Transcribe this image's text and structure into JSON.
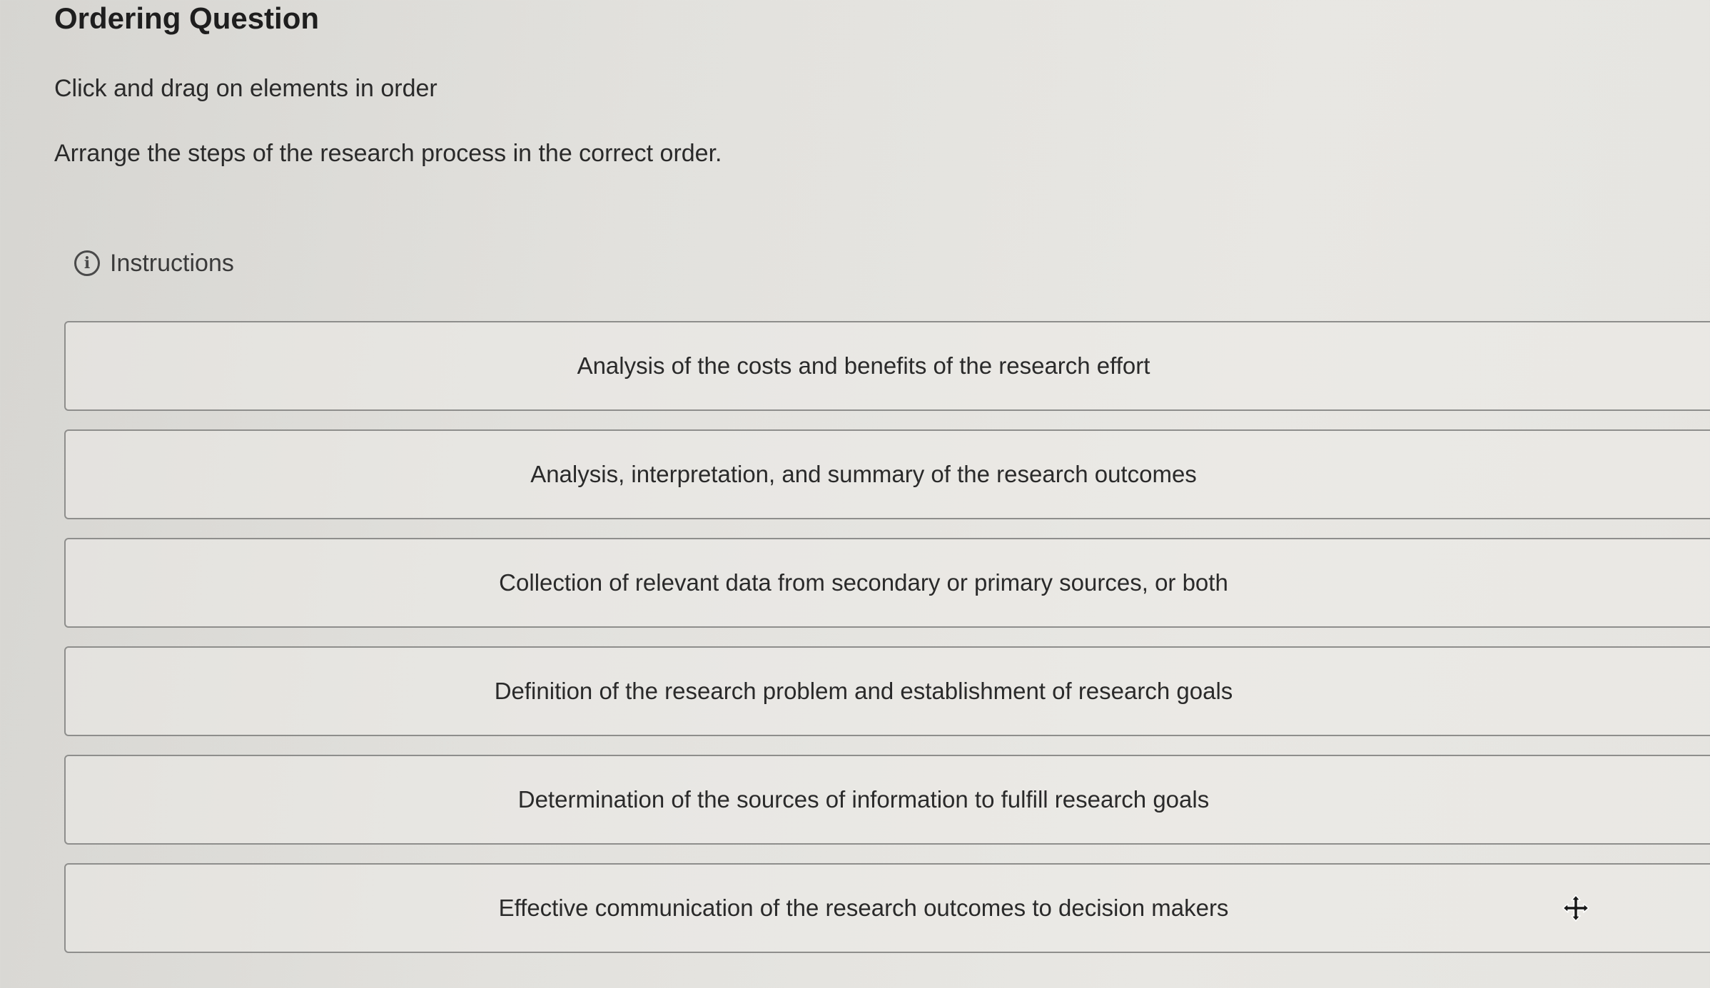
{
  "header": {
    "title": "Ordering Question",
    "subtitle": "Click and drag on elements in order",
    "prompt": "Arrange the steps of the research process in the correct order."
  },
  "instructions": {
    "icon": "info-icon",
    "label": "Instructions"
  },
  "items": [
    {
      "label": "Analysis of the costs and benefits of the research effort"
    },
    {
      "label": "Analysis, interpretation, and summary of the research outcomes"
    },
    {
      "label": "Collection of relevant data from secondary or primary sources, or both"
    },
    {
      "label": "Definition of the research problem and establishment of research goals"
    },
    {
      "label": "Determination of the sources of information to fulfill research goals"
    },
    {
      "label": "Effective communication of the research outcomes to decision makers"
    }
  ],
  "cursor": {
    "icon": "move-cursor-icon"
  }
}
